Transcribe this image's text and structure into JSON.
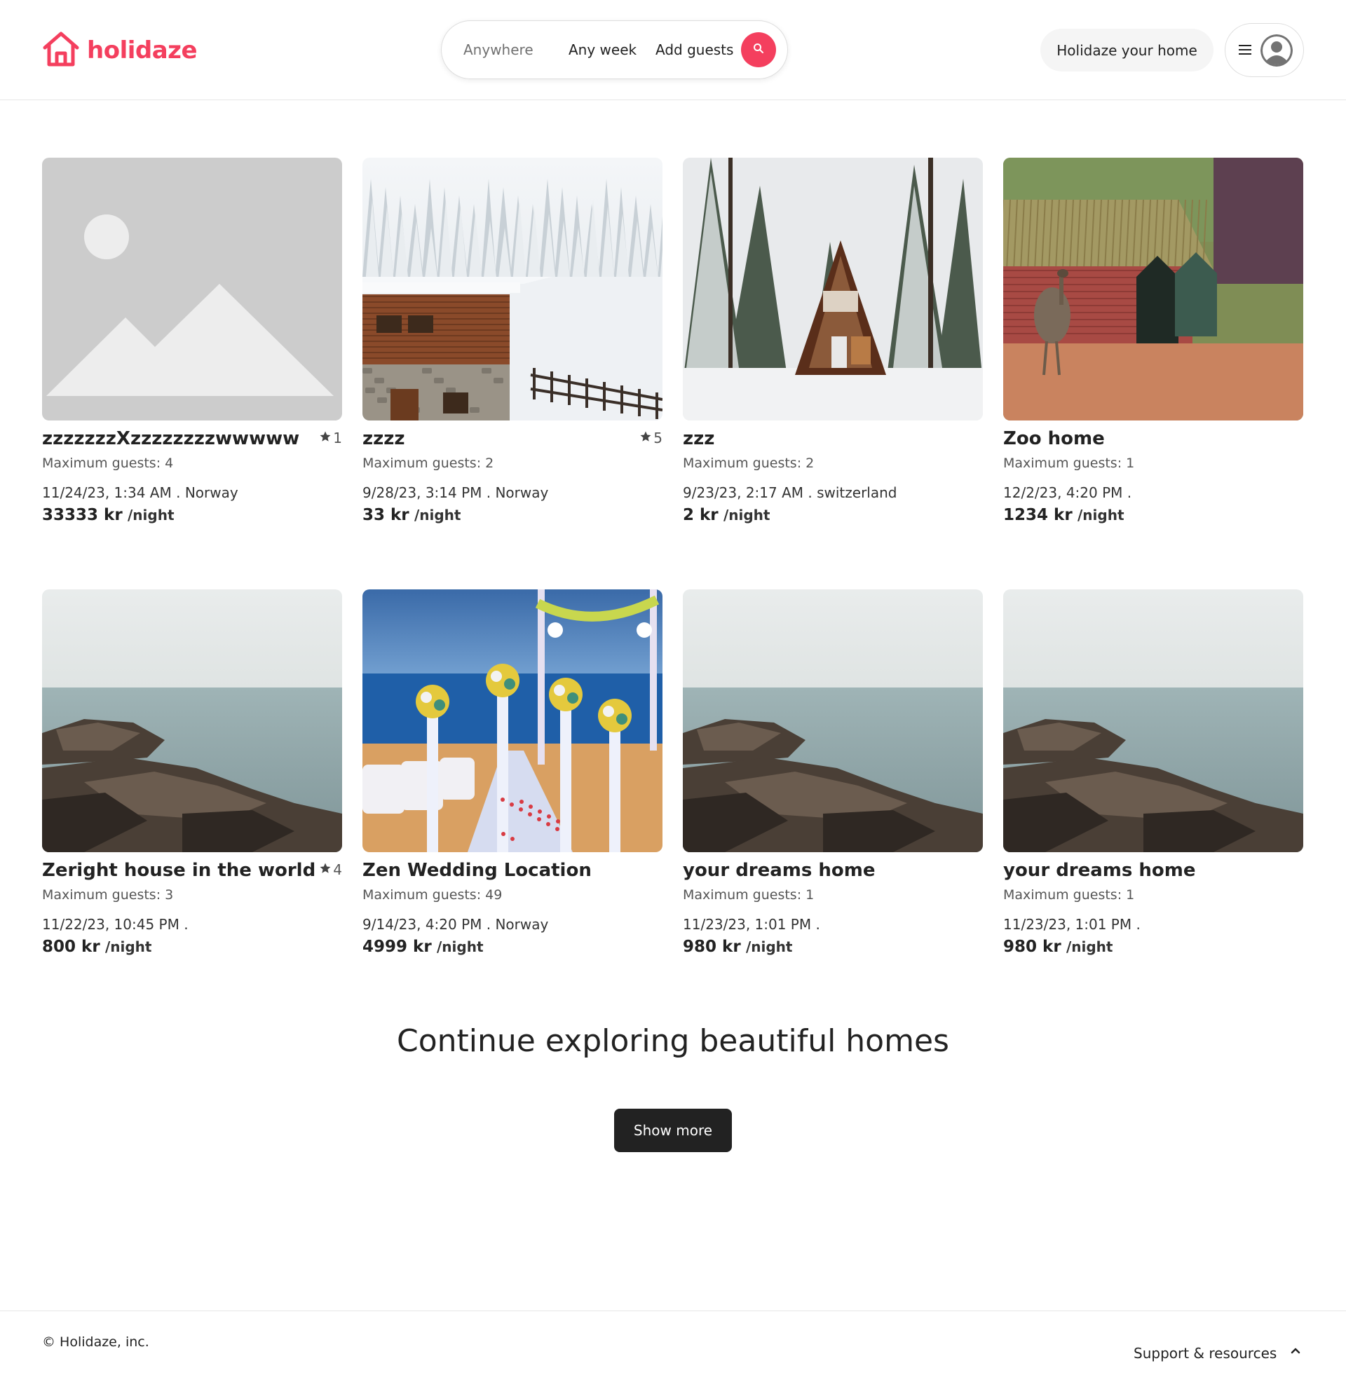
{
  "brand": {
    "name": "holidaze",
    "color": "#f43f5e",
    "icon": "house-icon"
  },
  "search": {
    "anywhere": "Anywhere",
    "any_week": "Any week",
    "add_guests": "Add guests",
    "icon": "search-icon"
  },
  "header": {
    "host_label": "Holidaze your home",
    "menu_icon": "hamburger-icon",
    "avatar_icon": "user-avatar-icon"
  },
  "listings": [
    {
      "title": "zzzzzzzXzzzzzzzzwwwww",
      "rating": "1",
      "guests": "Maximum guests: 4",
      "date": "11/24/23, 1:34 AM . Norway",
      "price": "33333 kr",
      "per": "/night",
      "image": "placeholder"
    },
    {
      "title": "zzzz",
      "rating": "5",
      "guests": "Maximum guests: 2",
      "date": "9/28/23, 3:14 PM . Norway",
      "price": "33 kr",
      "per": "/night",
      "image": "snow-chalet"
    },
    {
      "title": "zzz",
      "rating": "",
      "guests": "Maximum guests: 2",
      "date": "9/23/23, 2:17 AM . switzerland",
      "price": "2 kr",
      "per": "/night",
      "image": "a-frame-cabin"
    },
    {
      "title": "Zoo home",
      "rating": "",
      "guests": "Maximum guests: 1",
      "date": "12/2/23, 4:20 PM .",
      "price": "1234 kr",
      "per": "/night",
      "image": "zoo-house-emu"
    },
    {
      "title": "Zeright house in the world",
      "rating": "4",
      "guests": "Maximum guests: 3",
      "date": "11/22/23, 10:45 PM .",
      "price": "800 kr",
      "per": "/night",
      "image": "rocky-sea"
    },
    {
      "title": "Zen Wedding Location",
      "rating": "",
      "guests": "Maximum guests: 49",
      "date": "9/14/23, 4:20 PM . Norway",
      "price": "4999 kr",
      "per": "/night",
      "image": "beach-wedding"
    },
    {
      "title": "your dreams home",
      "rating": "",
      "guests": "Maximum guests: 1",
      "date": "11/23/23, 1:01 PM .",
      "price": "980 kr",
      "per": "/night",
      "image": "rocky-sea"
    },
    {
      "title": "your dreams home",
      "rating": "",
      "guests": "Maximum guests: 1",
      "date": "11/23/23, 1:01 PM .",
      "price": "980 kr",
      "per": "/night",
      "image": "rocky-sea"
    }
  ],
  "explore": {
    "title": "Continue exploring beautiful homes",
    "button": "Show more"
  },
  "footer": {
    "copyright": "© Holidaze, inc.",
    "support": "Support & resources",
    "chevron_icon": "chevron-up-icon"
  }
}
